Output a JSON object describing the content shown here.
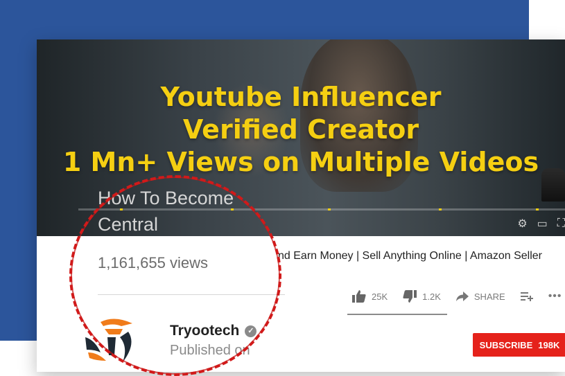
{
  "overlay": {
    "line1": "Youtube Influencer",
    "line2": "Verified Creator",
    "line3": "1 Mn+ Views on Multiple Videos",
    "accent_color": "#f5cf12"
  },
  "video": {
    "title_partial": "How To Become",
    "title_partial_2": "Central",
    "description_partial": "nd Earn Money | Sell Anything Online | Amazon Seller"
  },
  "stats": {
    "views": "1,161,655 views",
    "likes": "25K",
    "dislikes": "1.2K",
    "share_label": "SHARE"
  },
  "channel": {
    "name": "Tryootech",
    "published_partial": "Published on",
    "verified_icon": "verified-check-icon"
  },
  "subscribe": {
    "label": "SUBSCRIBE",
    "count": "198K",
    "color": "#e5221b"
  },
  "colors": {
    "background_block": "#2c559b",
    "highlight_circle": "#d11a1a"
  }
}
